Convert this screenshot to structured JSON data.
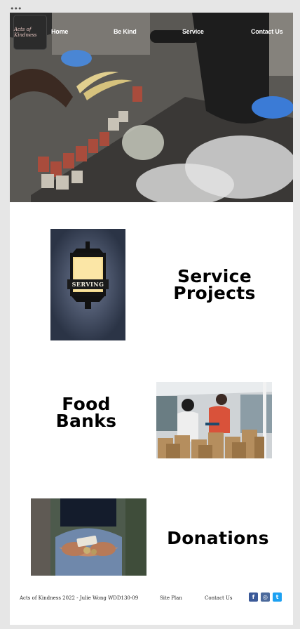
{
  "window": {
    "dots": "•••"
  },
  "header": {
    "logo_text": "Acts of Kindness",
    "nav": [
      {
        "label": "Home"
      },
      {
        "label": "Be Kind"
      },
      {
        "label": "Service"
      },
      {
        "label": "Contact Us"
      }
    ]
  },
  "sections": [
    {
      "heading_line1": "Service",
      "heading_line2": "Projects",
      "sign_text": "SERVING"
    },
    {
      "heading_line1": "Food",
      "heading_line2": "Banks"
    },
    {
      "heading_line1": "Donations"
    }
  ],
  "footer": {
    "credit": "Acts of Kindness 2022 - Julie Wong WDD130-09",
    "site_plan": "Site Plan",
    "contact": "Contact Us",
    "social": [
      {
        "icon": "facebook-icon",
        "glyph": "f",
        "color": "#3b5998"
      },
      {
        "icon": "instagram-icon",
        "glyph": "◎",
        "color": "#4c6a9c"
      },
      {
        "icon": "twitter-icon",
        "glyph": "t",
        "color": "#1da1f2"
      }
    ]
  }
}
